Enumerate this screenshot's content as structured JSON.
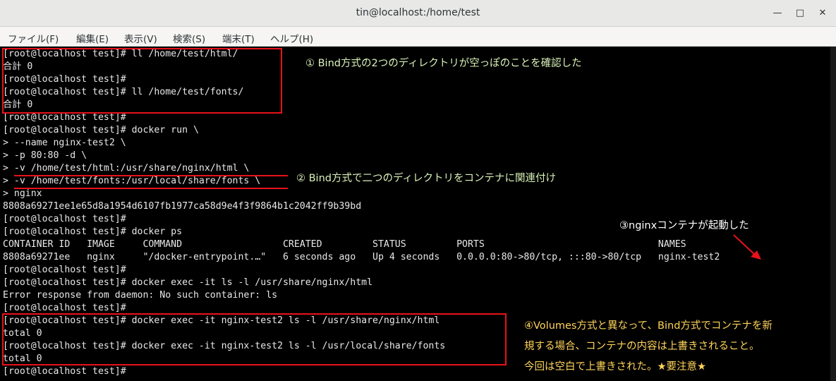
{
  "window": {
    "title": "tin@localhost:/home/test",
    "minimize_glyph": "—",
    "maximize_glyph": "□",
    "close_glyph": "✕"
  },
  "menu": [
    "ファイル(F)",
    "編集(E)",
    "表示(V)",
    "検索(S)",
    "端末(T)",
    "ヘルプ(H)"
  ],
  "terminal_lines": [
    "[root@localhost test]# ll /home/test/html/",
    "合計 0",
    "[root@localhost test]#",
    "[root@localhost test]# ll /home/test/fonts/",
    "合計 0",
    "[root@localhost test]#",
    "[root@localhost test]# docker run \\",
    "> --name nginx-test2 \\",
    "> -p 80:80 -d \\",
    "> -v /home/test/html:/usr/share/nginx/html \\",
    "> -v /home/test/fonts:/usr/local/share/fonts \\",
    "> nginx",
    "8808a69271ee1e65d8a1954d6107fb1977ca58d9e4f3f9864b1c2042ff9b39bd",
    "[root@localhost test]#",
    "[root@localhost test]# docker ps",
    "CONTAINER ID   IMAGE     COMMAND                  CREATED         STATUS         PORTS                               NAMES",
    "8808a69271ee   nginx     \"/docker-entrypoint.…\"   6 seconds ago   Up 4 seconds   0.0.0.0:80->80/tcp, :::80->80/tcp   nginx-test2",
    "[root@localhost test]#",
    "[root@localhost test]# docker exec -it ls -l /usr/share/nginx/html",
    "Error response from daemon: No such container: ls",
    "[root@localhost test]#",
    "[root@localhost test]# docker exec -it nginx-test2 ls -l /usr/share/nginx/html",
    "total 0",
    "[root@localhost test]# docker exec -it nginx-test2 ls -l /usr/local/share/fonts",
    "total 0",
    "[root@localhost test]#"
  ],
  "annotations": {
    "note1": "① Bind方式の2つのディレクトリが空っぽのことを確認した",
    "note2": "② Bind方式で二つのディレクトリをコンテナに関連付け",
    "note3": "③nginxコンテナが起動した",
    "note4_line1": "④Volumes方式と異なって、Bind方式でコンテナを新",
    "note4_line2": "規する場合、コンテナの内容は上書きされること。",
    "note4_line3": "今回は空白で上書きされた。★要注意★",
    "colors": {
      "highlight": "#e8121a",
      "note_green": "#d9f2b8",
      "note_yellow": "#ffd45a"
    }
  }
}
